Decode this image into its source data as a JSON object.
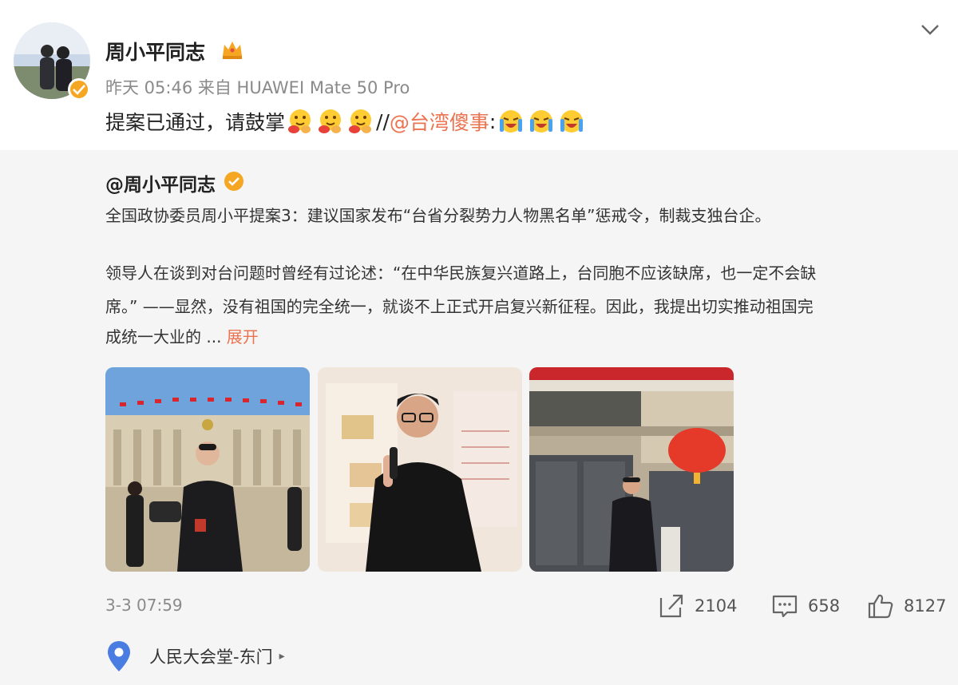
{
  "post": {
    "author_name": "周小平同志",
    "meta": "昨天 05:46 来自 HUAWEI Mate 50 Pro",
    "text_before": "提案已通过，请鼓掌",
    "text_sep": "//",
    "mention": "@台湾傻事",
    "mention_suffix": ":"
  },
  "repost": {
    "author": "@周小平同志",
    "paragraph1": "全国政协委员周小平提案3：建议国家发布“台省分裂势力人物黑名单”惩戒令，制裁支独台企。",
    "paragraph2_lines": [
      "领导人在谈到对台问题时曾经有过论述：“在中华民族复兴道路上，台同胞不应该缺席，也一定不会缺",
      "席。” ——显然，没有祖国的完全统一，就谈不上正式开启复兴新征程。因此，我提出切实推动祖国完",
      "成统一大业的 ..."
    ],
    "expand_label": "展开",
    "timestamp": "3-3 07:59",
    "share_count": "2104",
    "comment_count": "658",
    "like_count": "8127",
    "location": "人民大会堂-东门"
  },
  "icons": {
    "crown": "crown-icon",
    "verified": "verified-badge-icon",
    "chevron": "chevron-down-icon",
    "share": "share-icon",
    "comment": "comment-icon",
    "like": "thumbs-up-icon",
    "location": "location-pin-icon"
  },
  "colors": {
    "accent": "#eb7350",
    "meta_gray": "#8a8a8a",
    "repost_bg": "#f5f5f5",
    "badge": "#f5a623",
    "location_pin": "#4a7de2"
  }
}
